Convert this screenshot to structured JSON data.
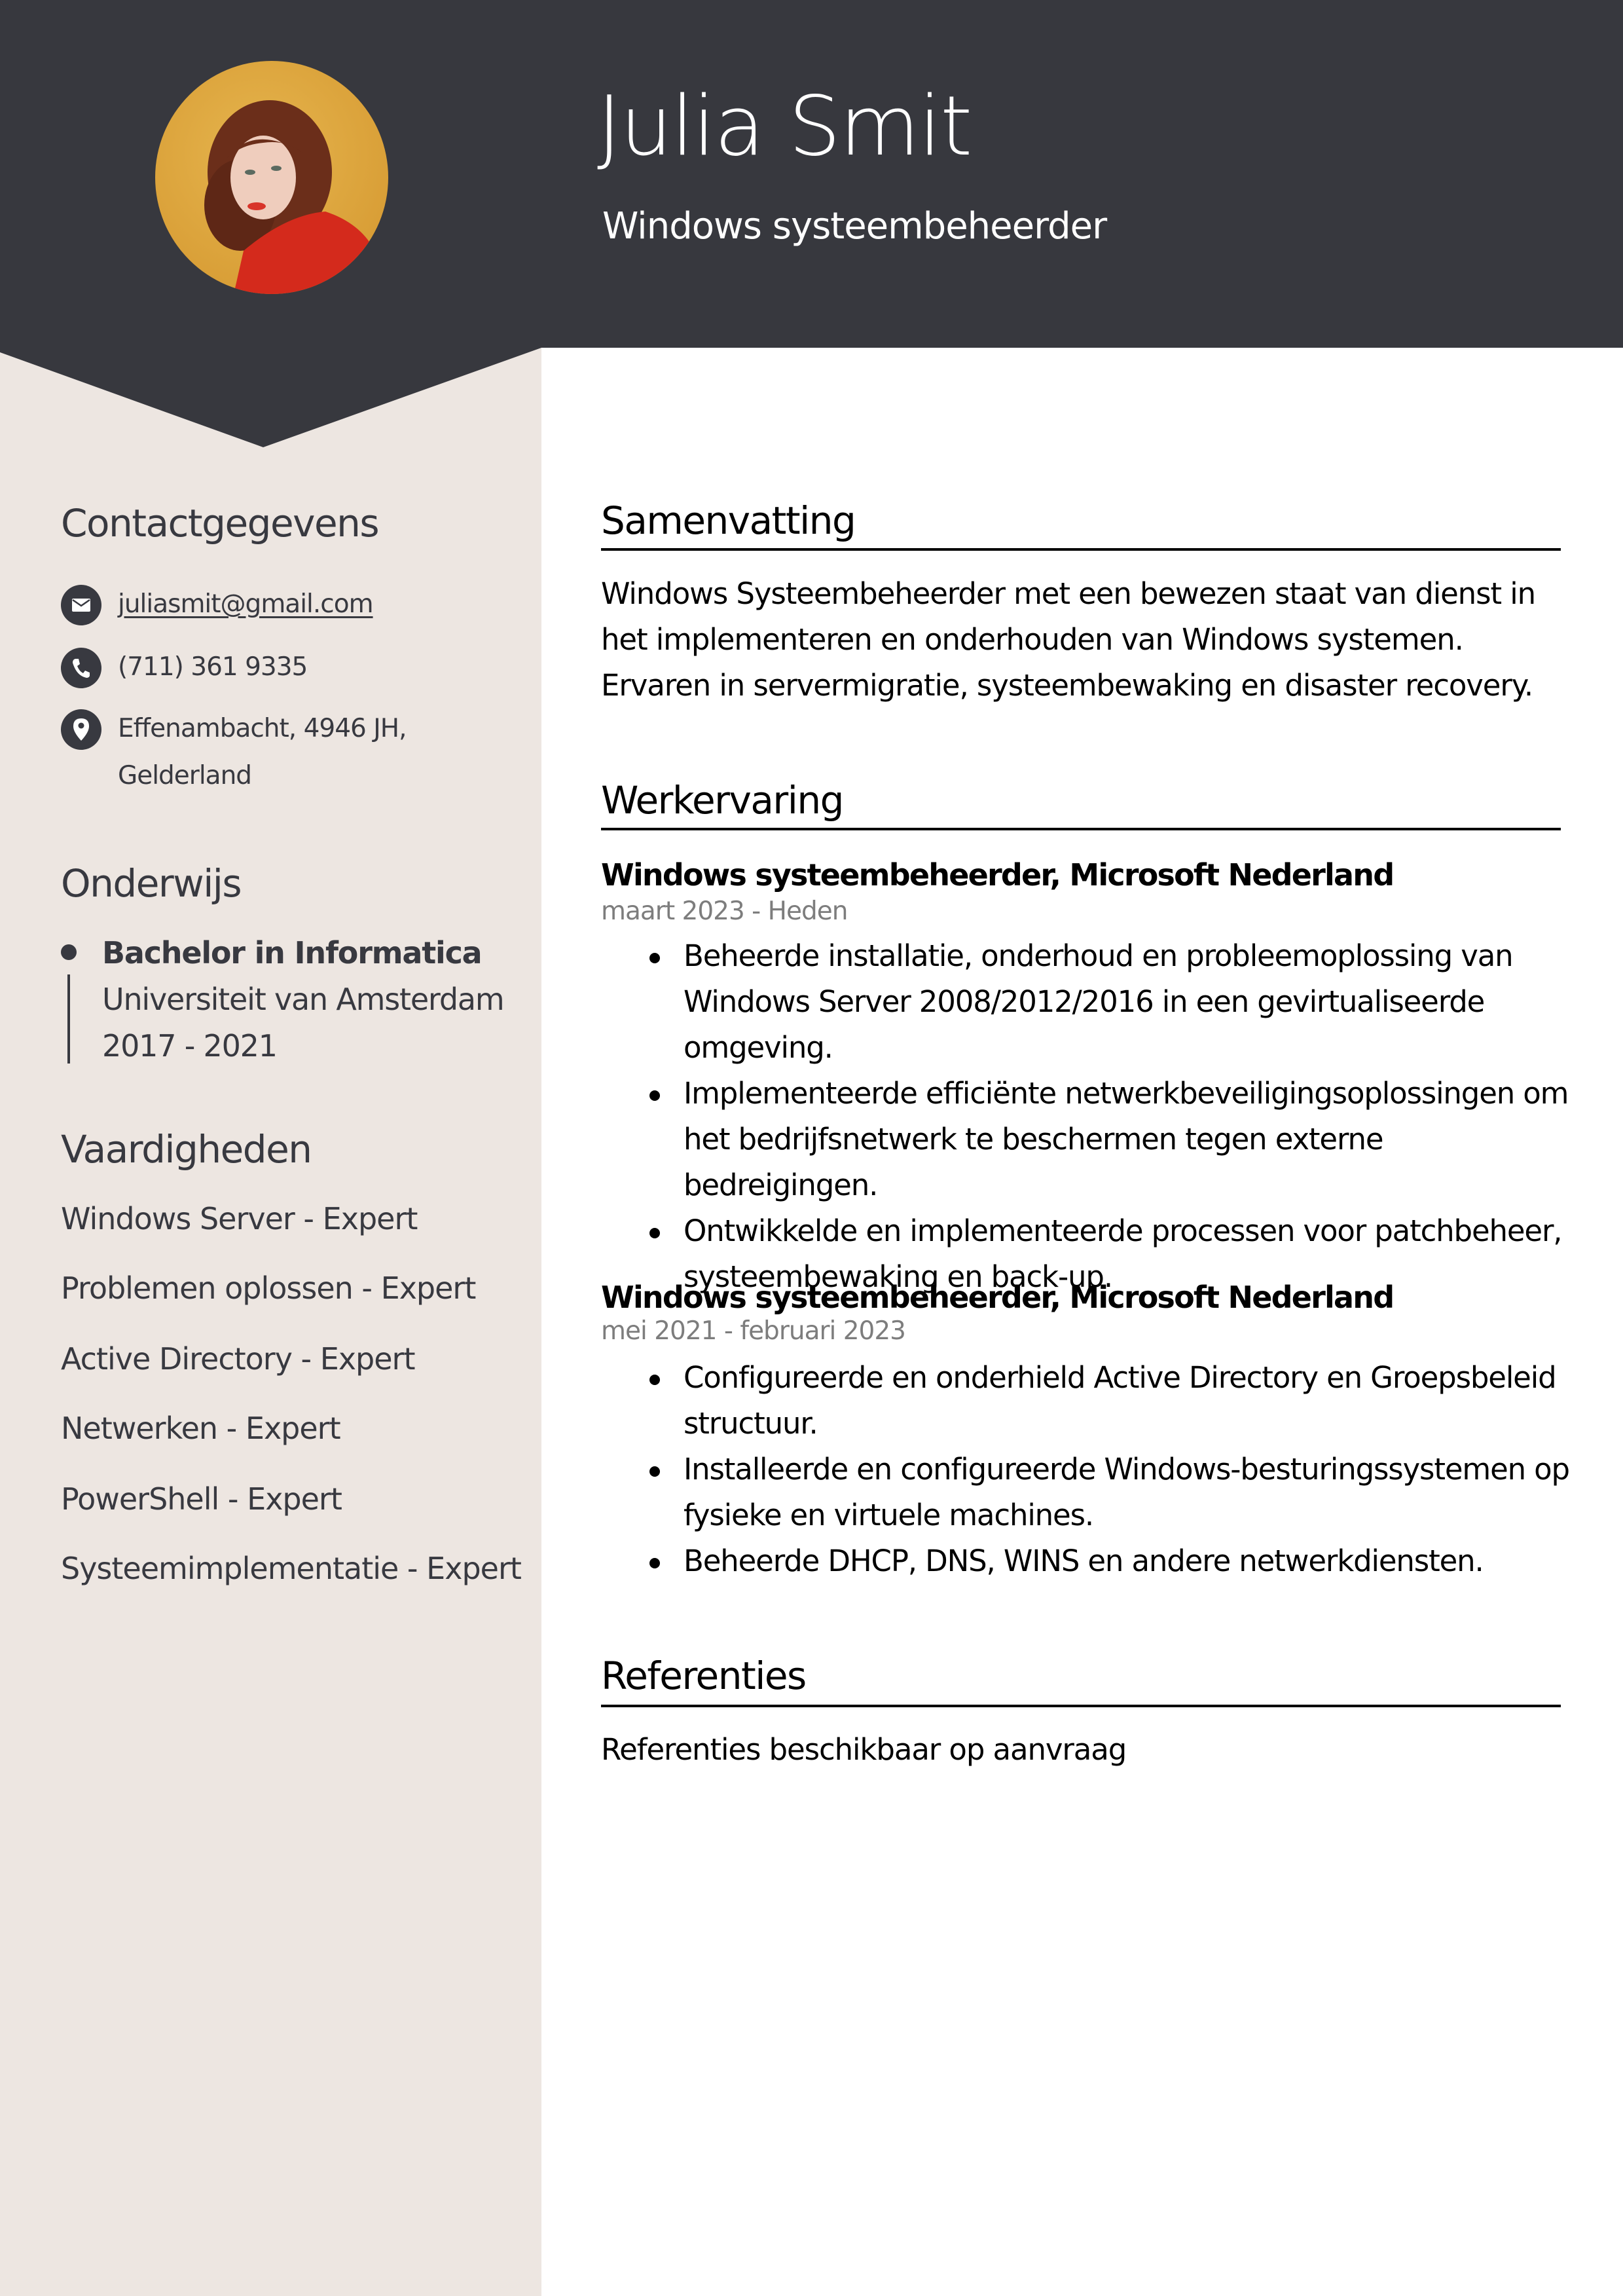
{
  "colors": {
    "header_bg": "#37383e",
    "sidebar_bg": "#ede6e1",
    "sidebar_text": "#383940",
    "date_text": "#7d7d7d"
  },
  "header": {
    "name": "Julia Smit",
    "job_title": "Windows systeembeheerder",
    "photo_alt": "Profielfoto van Julia Smit"
  },
  "sidebar": {
    "contact": {
      "heading": "Contactgegevens",
      "items": [
        {
          "icon": "envelope-icon",
          "text": "juliasmit@gmail.com",
          "type": "email"
        },
        {
          "icon": "phone-icon",
          "text": "(711) 361 9335",
          "type": "phone"
        },
        {
          "icon": "location-pin-icon",
          "text": "Effenambacht, 4946 JH, Gelderland",
          "line1": "Effenambacht, 4946 JH,",
          "line2": "Gelderland",
          "type": "address"
        }
      ]
    },
    "education": {
      "heading": "Onderwijs",
      "items": [
        {
          "degree": "Bachelor in Informatica",
          "school": "Universiteit van Amsterdam",
          "years": "2017 - 2021"
        }
      ]
    },
    "skills": {
      "heading": "Vaardigheden",
      "items": [
        "Windows Server - Expert",
        "Problemen oplossen - Expert",
        "Active Directory - Expert",
        "Netwerken - Expert",
        "PowerShell - Expert",
        "Systeemimplementatie - Expert"
      ]
    }
  },
  "main": {
    "summary": {
      "heading": "Samenvatting",
      "text": "Windows Systeembeheerder met een bewezen staat van dienst in het implementeren en onderhouden van Windows systemen. Ervaren in servermigratie, systeembewaking en disaster recovery."
    },
    "experience": {
      "heading": "Werkervaring",
      "jobs": [
        {
          "title": "Windows systeembeheerder, Microsoft Nederland",
          "dates": "maart 2023 - Heden",
          "bullets": [
            "Beheerde installatie, onderhoud en probleemoplossing van Windows Server 2008/2012/2016 in een gevirtualiseerde omgeving.",
            "Implementeerde efficiënte netwerkbeveiligingsoplossingen om het bedrijfsnetwerk te beschermen tegen externe bedreigingen.",
            "Ontwikkelde en implementeerde processen voor patchbeheer, systeembewaking en back-up."
          ]
        },
        {
          "title": "Windows systeembeheerder, Microsoft Nederland",
          "dates": "mei 2021 - februari 2023",
          "bullets": [
            "Configureerde en onderhield Active Directory en Groepsbeleid structuur.",
            "Installeerde en configureerde Windows-besturingssystemen op fysieke en virtuele machines.",
            "Beheerde DHCP, DNS, WINS en andere netwerkdiensten."
          ]
        }
      ]
    },
    "references": {
      "heading": "Referenties",
      "text": "Referenties beschikbaar op aanvraag"
    }
  }
}
